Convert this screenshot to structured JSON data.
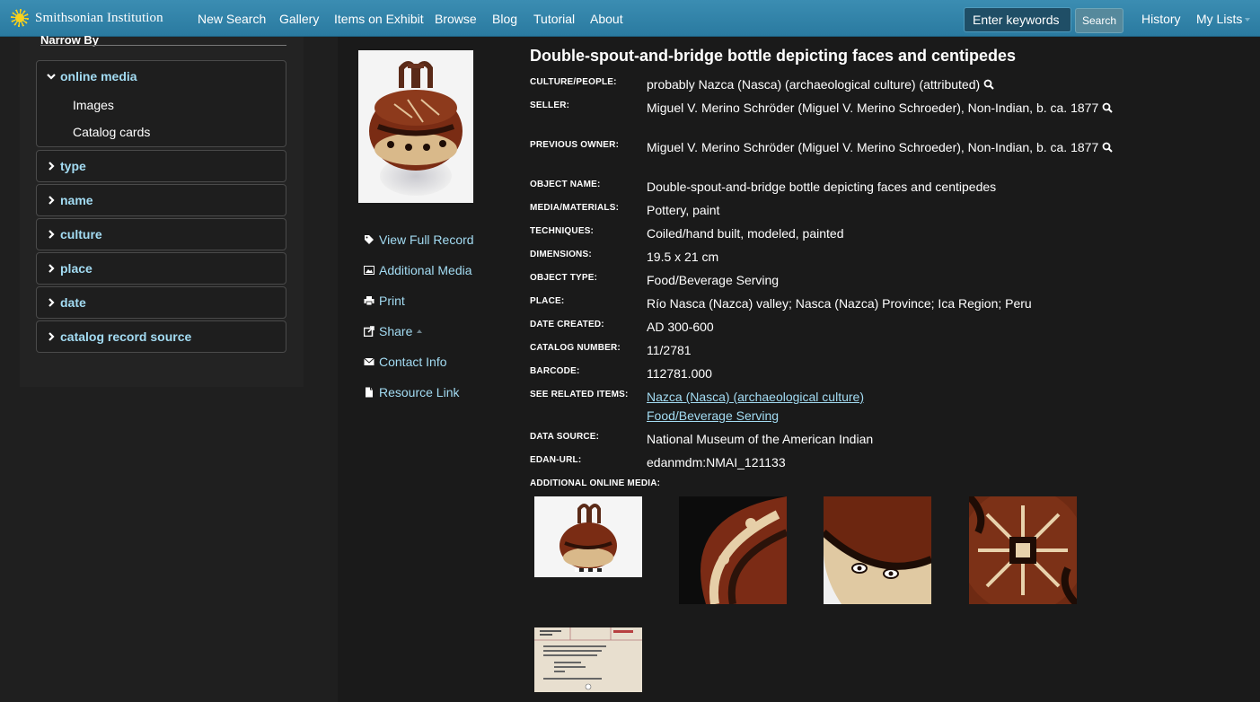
{
  "header": {
    "logo_text": "Smithsonian Institution",
    "nav": [
      "New Search",
      "Gallery",
      "Items on Exhibit",
      "Browse",
      "Blog",
      "Tutorial",
      "About"
    ],
    "search_placeholder": "Enter keywords",
    "search_button": "Search",
    "history": "History",
    "my_lists": "My Lists"
  },
  "sidebar": {
    "title": "Narrow By",
    "online_media": {
      "label": "online media",
      "items": [
        "Images",
        "Catalog cards"
      ]
    },
    "facets": [
      "type",
      "name",
      "culture",
      "place",
      "date",
      "catalog record source"
    ]
  },
  "actions": [
    "View Full Record",
    "Additional Media",
    "Print",
    "Share",
    "Contact Info",
    "Resource Link"
  ],
  "record": {
    "title": "Double-spout-and-bridge bottle depicting faces and centipedes",
    "fields": [
      {
        "label": "CULTURE/PEOPLE:",
        "value": "probably Nazca (Nasca) (archaeological culture) (attributed)"
      },
      {
        "label": "SELLER:",
        "value": "Miguel V. Merino Schröder (Miguel V. Merino Schroeder), Non-Indian, b. ca. 1877"
      },
      {
        "label": "PREVIOUS OWNER:",
        "value": "Miguel V. Merino Schröder (Miguel V. Merino Schroeder), Non-Indian, b. ca. 1877"
      },
      {
        "label": "OBJECT NAME:",
        "value": "Double-spout-and-bridge bottle depicting faces and centipedes"
      },
      {
        "label": "MEDIA/MATERIALS:",
        "value": "Pottery, paint"
      },
      {
        "label": "TECHNIQUES:",
        "value": "Coiled/hand built, modeled, painted"
      },
      {
        "label": "DIMENSIONS:",
        "value": "19.5 x 21 cm"
      },
      {
        "label": "OBJECT TYPE:",
        "value": "Food/Beverage Serving"
      },
      {
        "label": "PLACE:",
        "value": "Río Nasca (Nazca) valley; Nasca (Nazca) Province; Ica Region; Peru"
      },
      {
        "label": "DATE CREATED:",
        "value": "AD 300-600"
      },
      {
        "label": "CATALOG NUMBER:",
        "value": "11/2781"
      },
      {
        "label": "BARCODE:",
        "value": "112781.000"
      },
      {
        "label": "SEE RELATED ITEMS:",
        "links": [
          "Nazca (Nasca) (archaeological culture)",
          "Food/Beverage Serving"
        ]
      },
      {
        "label": "DATA SOURCE:",
        "value": "National Museum of the American Indian"
      },
      {
        "label": "EDAN-URL:",
        "value": "edanmdm:NMAI_121133"
      },
      {
        "label": "ADDITIONAL ONLINE MEDIA:"
      }
    ]
  },
  "colors": {
    "nav_bg": "#2f82a8",
    "link": "#a3dcf3",
    "page_bg": "#1a1a1a"
  }
}
